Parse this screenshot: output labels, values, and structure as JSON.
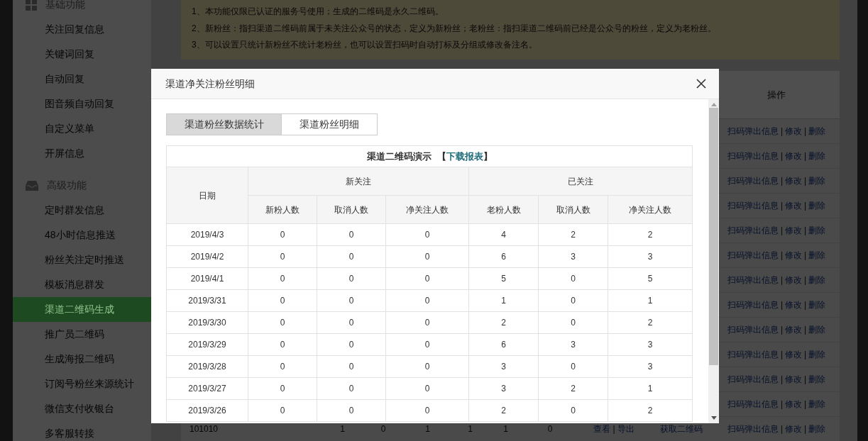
{
  "sidebar": {
    "sections": [
      {
        "title": "基础功能",
        "items": [
          {
            "label": "关注回复信息",
            "selected": false
          },
          {
            "label": "关键词回复",
            "selected": false
          },
          {
            "label": "自动回复",
            "selected": false
          },
          {
            "label": "图音频自动回复",
            "selected": false
          },
          {
            "label": "自定义菜单",
            "selected": false
          },
          {
            "label": "开屏信息",
            "selected": false
          }
        ]
      },
      {
        "title": "高级功能",
        "items": [
          {
            "label": "定时群发信息",
            "selected": false
          },
          {
            "label": "48小时信息推送",
            "selected": false
          },
          {
            "label": "粉丝关注定时推送",
            "selected": false
          },
          {
            "label": "模板消息群发",
            "selected": false
          },
          {
            "label": "渠道二维码生成",
            "selected": true
          },
          {
            "label": "推广员二维码",
            "selected": false
          },
          {
            "label": "生成海报二维码",
            "selected": false
          },
          {
            "label": "订阅号粉丝来源统计",
            "selected": false
          },
          {
            "label": "微信支付收银台",
            "selected": false
          },
          {
            "label": "多客服转接",
            "selected": false
          }
        ]
      }
    ]
  },
  "notice": [
    "1、本功能仅限已认证的服务号使用；生成的二维码是永久二维码。",
    "2、新粉丝：指扫渠道二维码前属于未关注公众号的状态，定义为新粉丝；老粉丝：指扫渠道二维码前已经是公众号的粉丝，定义为老粉丝。",
    "3、可以设置只统计新粉丝不统计老粉丝，也可以设置扫码时自动打标及分组或修改备注名。"
  ],
  "background_table": {
    "action_header": "操作",
    "rows": [
      {
        "actions": [
          "扫码弹出信息",
          "|",
          "修改",
          "|",
          "删除"
        ]
      },
      {
        "actions": [
          "扫码弹出信息",
          "|",
          "修改",
          "|",
          "删除"
        ]
      },
      {
        "actions": [
          "扫码弹出信息",
          "|",
          "修改",
          "|",
          "删除"
        ]
      },
      {
        "actions": [
          "扫码弹出信息",
          "|",
          "修改",
          "|",
          "删除"
        ]
      },
      {
        "actions": [
          "扫码弹出信息",
          "|",
          "修改",
          "|",
          "删除"
        ]
      },
      {
        "actions": [
          "扫码弹出信息",
          "|",
          "修改",
          "|",
          "删除"
        ]
      },
      {
        "actions": [
          "扫码弹出信息",
          "|",
          "修改",
          "|",
          "删除"
        ]
      },
      {
        "actions": [
          "扫码弹出信息",
          "|",
          "修改",
          "|",
          "删除"
        ]
      },
      {
        "actions": [
          "扫码弹出信息",
          "|",
          "修改",
          "|",
          "删除"
        ]
      },
      {
        "actions": [
          "扫码弹出信息",
          "|",
          "修改",
          "|",
          "删除"
        ]
      },
      {
        "actions": [
          "扫码弹出信息",
          "|",
          "修改",
          "|",
          "删除"
        ]
      },
      {
        "actions": [
          "扫码弹出信息",
          "|",
          "修改",
          "|",
          "删除"
        ]
      },
      {
        "cells": [
          "101010",
          "1",
          "0",
          "1",
          "1",
          "1",
          "0"
        ],
        "links": [
          "查看",
          "|",
          "导出"
        ],
        "qr_link": "获取二维码",
        "actions": [
          "扫码弹出信息",
          "|",
          "修改",
          "|",
          "删除"
        ]
      }
    ]
  },
  "modal": {
    "title": "渠道净关注粉丝明细",
    "tabs": [
      {
        "label": "渠道粉丝数据统计",
        "selected": true
      },
      {
        "label": "渠道粉丝明细",
        "selected": false
      }
    ],
    "table": {
      "caption": "渠道二维码演示",
      "bracket_open": "【",
      "link": "下载报表",
      "bracket_close": "】",
      "date_header": "日期",
      "groups": [
        {
          "label": "新关注",
          "columns": [
            "新粉人数",
            "取消人数",
            "净关注人数"
          ]
        },
        {
          "label": "已关注",
          "columns": [
            "老粉人数",
            "取消人数",
            "净关注人数"
          ]
        }
      ],
      "rows": [
        {
          "date": "2019/4/3",
          "values": [
            "0",
            "0",
            "0",
            "4",
            "2",
            "2"
          ]
        },
        {
          "date": "2019/4/2",
          "values": [
            "0",
            "0",
            "0",
            "6",
            "3",
            "3"
          ]
        },
        {
          "date": "2019/4/1",
          "values": [
            "0",
            "0",
            "0",
            "5",
            "0",
            "5"
          ]
        },
        {
          "date": "2019/3/31",
          "values": [
            "0",
            "0",
            "0",
            "1",
            "0",
            "1"
          ]
        },
        {
          "date": "2019/3/30",
          "values": [
            "0",
            "0",
            "0",
            "2",
            "0",
            "2"
          ]
        },
        {
          "date": "2019/3/29",
          "values": [
            "0",
            "0",
            "0",
            "6",
            "3",
            "3"
          ]
        },
        {
          "date": "2019/3/28",
          "values": [
            "0",
            "0",
            "0",
            "3",
            "0",
            "3"
          ]
        },
        {
          "date": "2019/3/27",
          "values": [
            "0",
            "0",
            "0",
            "3",
            "2",
            "1"
          ]
        },
        {
          "date": "2019/3/26",
          "values": [
            "0",
            "0",
            "0",
            "2",
            "0",
            "2"
          ]
        }
      ]
    }
  }
}
